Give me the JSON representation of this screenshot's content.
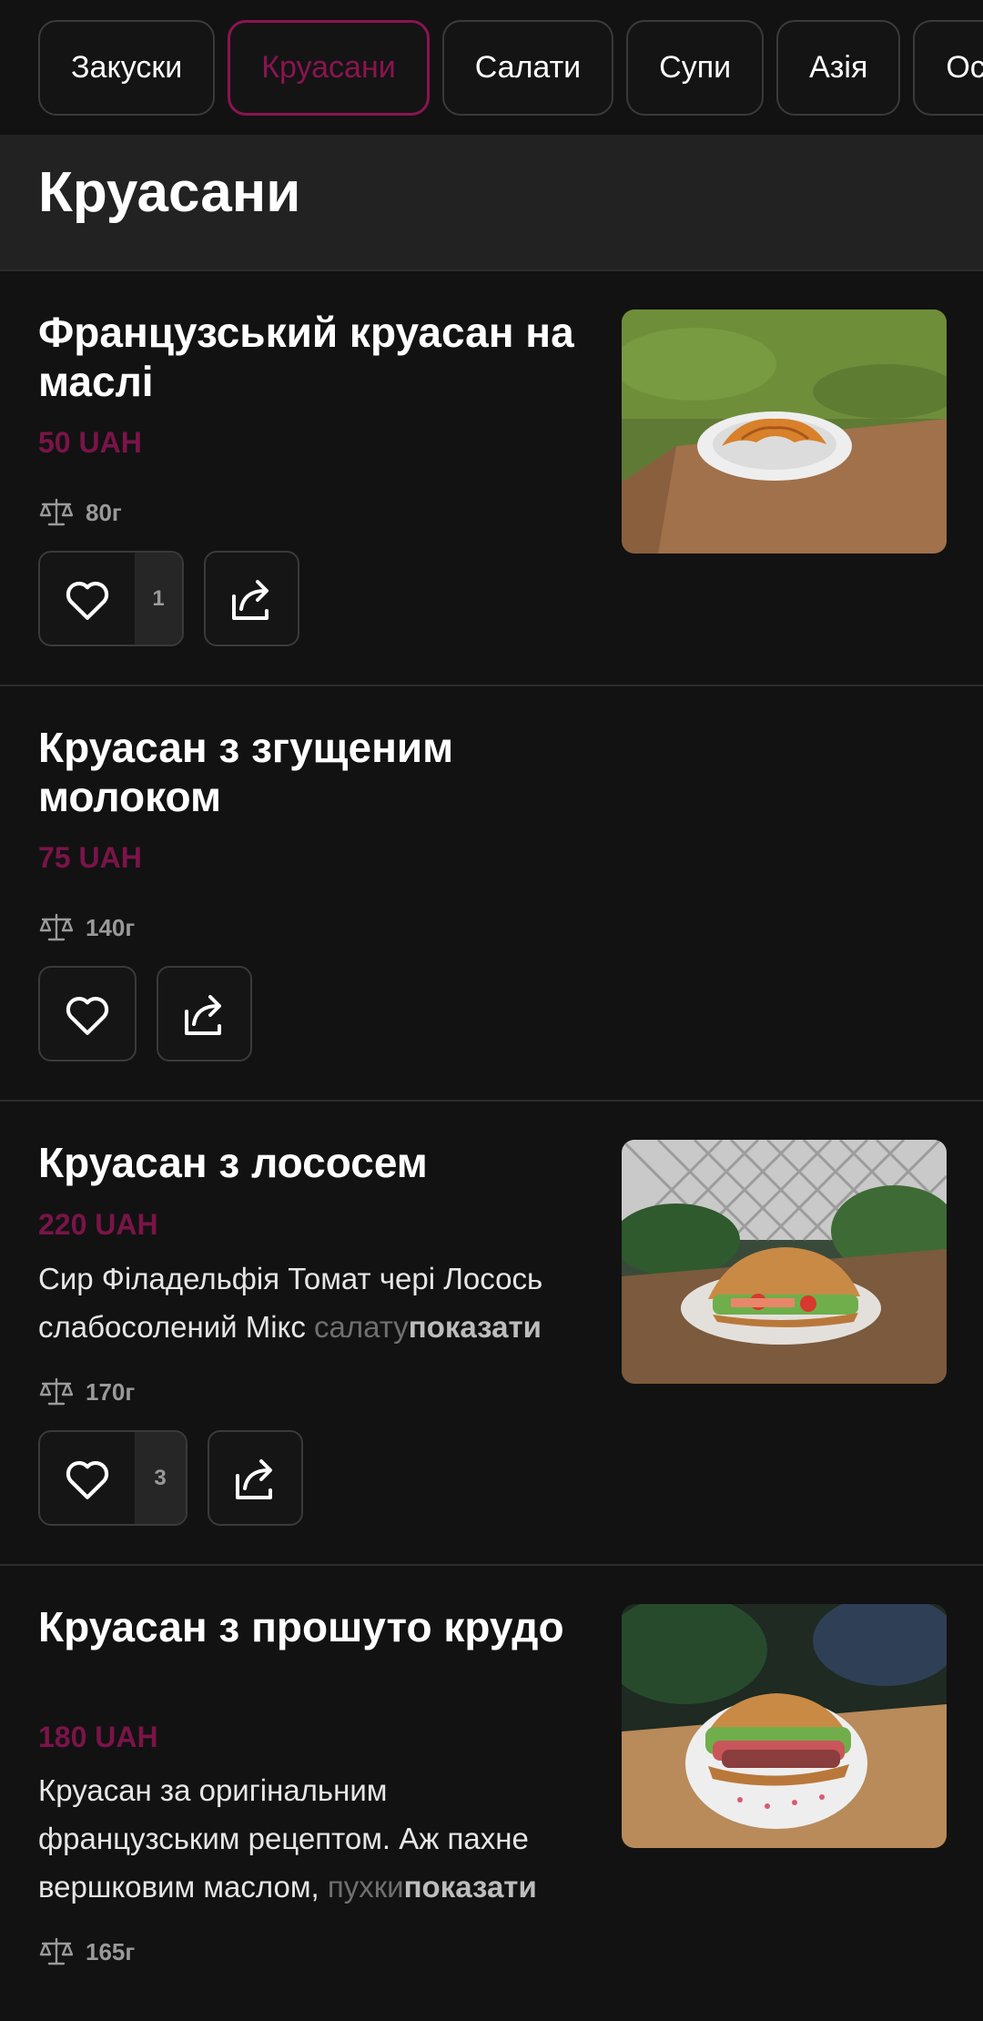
{
  "tabs": [
    {
      "label": "Закуски",
      "active": false
    },
    {
      "label": "Круасани",
      "active": true
    },
    {
      "label": "Салати",
      "active": false
    },
    {
      "label": "Супи",
      "active": false
    },
    {
      "label": "Азія",
      "active": false
    },
    {
      "label": "Осно",
      "active": false
    }
  ],
  "section": {
    "title": "Круасани"
  },
  "colors": {
    "accent": "#8a1450",
    "price": "#7a1448",
    "background": "#121212"
  },
  "items": [
    {
      "title": "Французський круасан на маслі",
      "price": "50 UAH",
      "weight": "80г",
      "likes": "1",
      "image": "croissant-plate-photo"
    },
    {
      "title": "Круасан з згущеним молоком",
      "price": "75 UAH",
      "weight": "140г",
      "likes": null
    },
    {
      "title": "Круасан з лососем",
      "price": "220 UAH",
      "desc_visible": "Сир Філадельфія Томат чері Лосось слабосолений Мікс ",
      "desc_faded": "салату",
      "more_label": "показати",
      "weight": "170г",
      "likes": "3",
      "image": "salmon-croissant-photo"
    },
    {
      "title": "Круасан з прошуто крудо",
      "price": "180 UAH",
      "desc_visible": "Круасан за оригінальним французським рецептом. Аж пахне вершковим маслом, ",
      "desc_faded": "пухки",
      "more_label": "показати",
      "weight": "165г",
      "image": "prosciutto-croissant-photo"
    }
  ],
  "icons": {
    "like": "heart-outline-icon",
    "share": "share-arrow-icon",
    "weight": "scales-icon"
  }
}
